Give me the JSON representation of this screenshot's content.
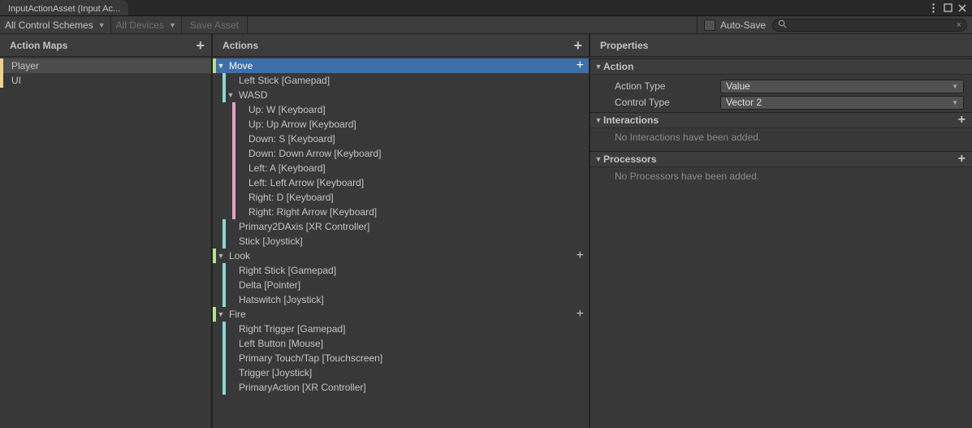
{
  "tab_title": "InputActionAsset (Input Ac...",
  "toolbar": {
    "control_schemes": "All Control Schemes",
    "devices": "All Devices",
    "save_label": "Save Asset",
    "auto_save_label": "Auto-Save",
    "search_placeholder": ""
  },
  "columns": {
    "action_maps_header": "Action Maps",
    "actions_header": "Actions",
    "properties_header": "Properties"
  },
  "action_maps": [
    {
      "name": "Player",
      "selected": true
    },
    {
      "name": "UI",
      "selected": false
    }
  ],
  "actions_tree": [
    {
      "depth": 0,
      "color": "green",
      "label": "Move",
      "fold": "down",
      "add": true,
      "selected": true
    },
    {
      "depth": 1,
      "color": "teal",
      "label": "Left Stick [Gamepad]"
    },
    {
      "depth": 1,
      "color": "teal",
      "label": "WASD",
      "fold": "down"
    },
    {
      "depth": 2,
      "color": "pink",
      "label": "Up: W [Keyboard]"
    },
    {
      "depth": 2,
      "color": "pink",
      "label": "Up: Up Arrow [Keyboard]"
    },
    {
      "depth": 2,
      "color": "pink",
      "label": "Down: S [Keyboard]"
    },
    {
      "depth": 2,
      "color": "pink",
      "label": "Down: Down Arrow [Keyboard]"
    },
    {
      "depth": 2,
      "color": "pink",
      "label": "Left: A [Keyboard]"
    },
    {
      "depth": 2,
      "color": "pink",
      "label": "Left: Left Arrow [Keyboard]"
    },
    {
      "depth": 2,
      "color": "pink",
      "label": "Right: D [Keyboard]"
    },
    {
      "depth": 2,
      "color": "pink",
      "label": "Right: Right Arrow [Keyboard]"
    },
    {
      "depth": 1,
      "color": "teal",
      "label": "Primary2DAxis [XR Controller]"
    },
    {
      "depth": 1,
      "color": "teal",
      "label": "Stick [Joystick]"
    },
    {
      "depth": 0,
      "color": "green",
      "label": "Look",
      "fold": "down",
      "add": true
    },
    {
      "depth": 1,
      "color": "teal",
      "label": "Right Stick [Gamepad]"
    },
    {
      "depth": 1,
      "color": "teal",
      "label": "Delta [Pointer]"
    },
    {
      "depth": 1,
      "color": "teal",
      "label": "Hatswitch [Joystick]"
    },
    {
      "depth": 0,
      "color": "green",
      "label": "Fire",
      "fold": "down",
      "add": true
    },
    {
      "depth": 1,
      "color": "teal",
      "label": "Right Trigger [Gamepad]"
    },
    {
      "depth": 1,
      "color": "teal",
      "label": "Left Button [Mouse]"
    },
    {
      "depth": 1,
      "color": "teal",
      "label": "Primary Touch/Tap [Touchscreen]"
    },
    {
      "depth": 1,
      "color": "teal",
      "label": "Trigger [Joystick]"
    },
    {
      "depth": 1,
      "color": "teal",
      "label": "PrimaryAction [XR Controller]"
    }
  ],
  "properties": {
    "action_section": "Action",
    "action_type_label": "Action Type",
    "action_type_value": "Value",
    "control_type_label": "Control Type",
    "control_type_value": "Vector 2",
    "interactions_section": "Interactions",
    "interactions_empty": "No Interactions have been added.",
    "processors_section": "Processors",
    "processors_empty": "No Processors have been added."
  }
}
